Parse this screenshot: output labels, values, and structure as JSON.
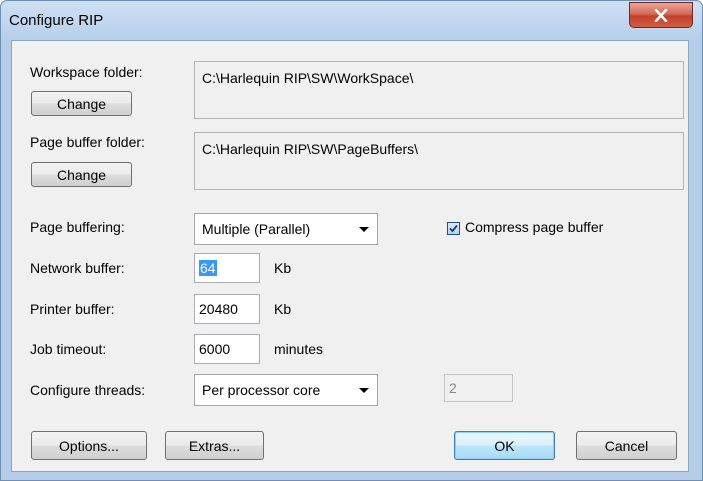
{
  "window": {
    "title": "Configure RIP"
  },
  "workspace": {
    "label": "Workspace folder:",
    "change_label": "Change",
    "path": "C:\\Harlequin RIP\\SW\\WorkSpace\\"
  },
  "pagebuffer_folder": {
    "label": "Page buffer folder:",
    "change_label": "Change",
    "path": "C:\\Harlequin RIP\\SW\\PageBuffers\\"
  },
  "page_buffering": {
    "label": "Page buffering:",
    "value": "Multiple (Parallel)"
  },
  "compress": {
    "label": "Compress page buffer",
    "checked": true
  },
  "network_buffer": {
    "label": "Network buffer:",
    "value": "64",
    "unit": "Kb"
  },
  "printer_buffer": {
    "label": "Printer buffer:",
    "value": "20480",
    "unit": "Kb"
  },
  "job_timeout": {
    "label": "Job timeout:",
    "value": "6000",
    "unit": "minutes"
  },
  "threads": {
    "label": "Configure threads:",
    "value": "Per processor core",
    "count": "2"
  },
  "buttons": {
    "options": "Options...",
    "extras": "Extras...",
    "ok": "OK",
    "cancel": "Cancel"
  },
  "icons": {
    "close": "close-icon",
    "dropdown": "chevron-down-icon",
    "check": "checkmark-icon"
  },
  "colors": {
    "selection": "#3399ff",
    "close_button": "#c2412c",
    "default_button_border": "#3c7fb1"
  }
}
